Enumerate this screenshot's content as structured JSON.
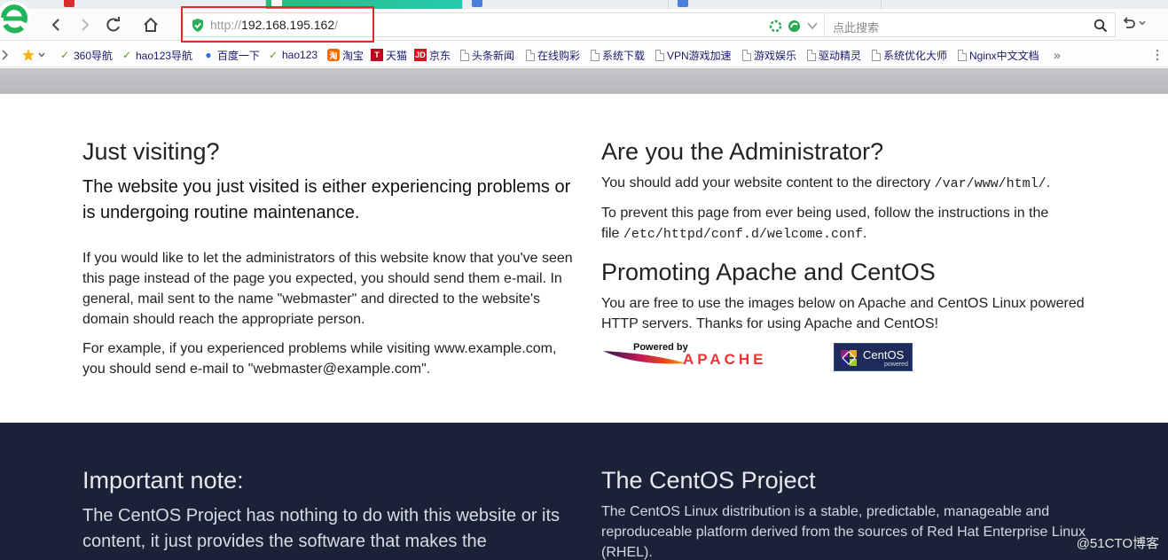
{
  "browser": {
    "url_scheme": "http://",
    "url_host": "192.168.195.162",
    "url_path": "/",
    "search_placeholder": "点此搜索",
    "bookmarks": [
      {
        "label": "360导航"
      },
      {
        "label": "hao123导航"
      },
      {
        "label": "百度一下"
      },
      {
        "label": "hao123"
      },
      {
        "label": "淘宝"
      },
      {
        "label": "天猫"
      },
      {
        "label": "京东"
      },
      {
        "label": "头条新闻"
      },
      {
        "label": "在线购彩"
      },
      {
        "label": "系统下载"
      },
      {
        "label": "VPN游戏加速"
      },
      {
        "label": "游戏娱乐"
      },
      {
        "label": "驱动精灵"
      },
      {
        "label": "系统优化大师"
      },
      {
        "label": "Nginx中文文档"
      }
    ],
    "bookmark_overflow": "»"
  },
  "visiting": {
    "heading": "Just visiting?",
    "lead": "The website you just visited is either experiencing problems or is undergoing routine maintenance.",
    "p1": "If you would like to let the administrators of this website know that you've seen this page instead of the page you expected, you should send them e-mail. In general, mail sent to the name \"webmaster\" and directed to the website's domain should reach the appropriate person.",
    "p2": "For example, if you experienced problems while visiting www.example.com, you should send e-mail to \"webmaster@example.com\"."
  },
  "admin": {
    "heading": "Are you the Administrator?",
    "p1_pre": "You should add your website content to the directory ",
    "p1_code": "/var/www/html/",
    "p1_post": ".",
    "p2_pre": "To prevent this page from ever being used, follow the instructions in the file ",
    "p2_code": "/etc/httpd/conf.d/welcome.conf",
    "p2_post": "."
  },
  "promoting": {
    "heading": "Promoting Apache and CentOS",
    "p": "You are free to use the images below on Apache and CentOS Linux powered HTTP servers. Thanks for using Apache and CentOS!",
    "apache_badge_top": "Powered by",
    "apache_badge_word": "APACHE",
    "centos_badge_word": "CentOS",
    "centos_badge_sub": "powered"
  },
  "footer": {
    "note_heading": "Important note:",
    "note_lead": "The CentOS Project has nothing to do with this website or its content, it just provides the software that makes the",
    "project_heading": "The CentOS Project",
    "project_p": "The CentOS Linux distribution is a stable, predictable, manageable and reproduceable platform derived from the sources of Red Hat Enterprise Linux (RHEL)."
  },
  "watermark": "@51CTO博客",
  "colors": {
    "highlight_box": "#e8272d",
    "footer_bg": "#1b2238",
    "banner_bg": "#c1c1c5",
    "active_tab": "#1ec07a"
  }
}
